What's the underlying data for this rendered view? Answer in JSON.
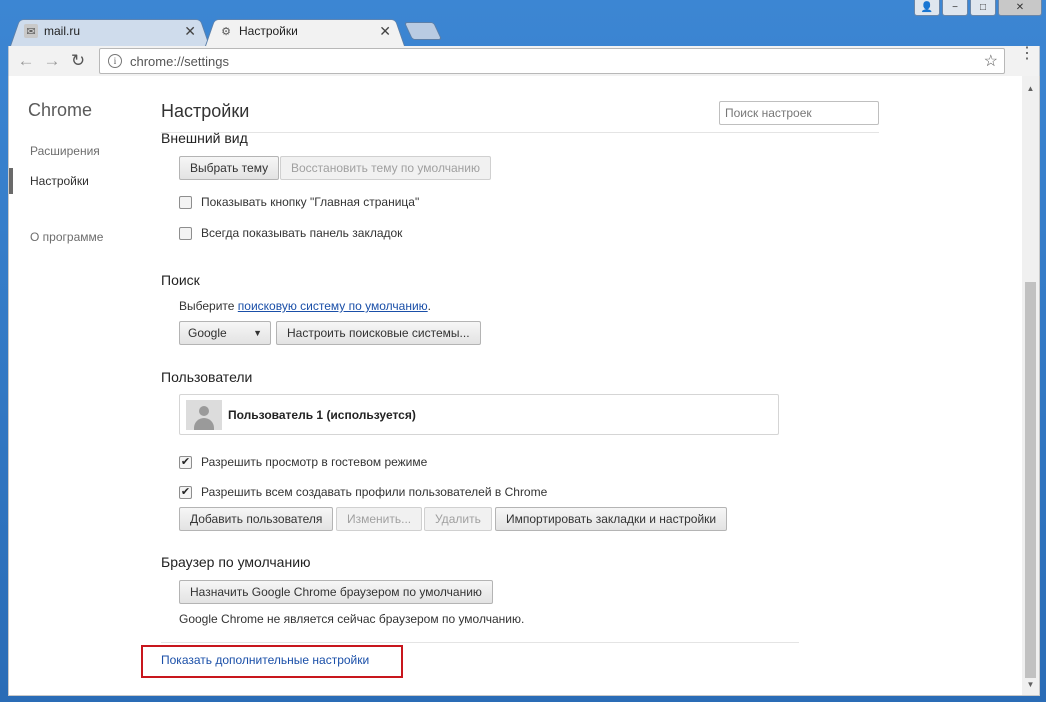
{
  "window": {
    "minimize_icon": "−",
    "maximize_icon": "□",
    "close_icon": "✕"
  },
  "tabs": [
    {
      "title": "mail.ru",
      "icon": "mail-icon",
      "active": false
    },
    {
      "title": "Настройки",
      "icon": "gear-icon",
      "active": true
    }
  ],
  "toolbar": {
    "back": "←",
    "forward": "→",
    "reload": "↻",
    "url": "chrome://settings",
    "info_icon": "i",
    "star": "☆",
    "menu": "⋮"
  },
  "nav": {
    "title": "Chrome",
    "items": [
      {
        "label": "Расширения"
      },
      {
        "label": "Настройки"
      },
      {
        "label": "О программе"
      }
    ]
  },
  "header": {
    "title": "Настройки",
    "search_placeholder": "Поиск настроек"
  },
  "appearance": {
    "title": "Внешний вид",
    "choose_theme": "Выбрать тему",
    "reset_theme": "Восстановить тему по умолчанию",
    "show_home": "Показывать кнопку \"Главная страница\"",
    "show_bookmarks": "Всегда показывать панель закладок"
  },
  "search": {
    "title": "Поиск",
    "prefix": "Выберите ",
    "link": "поисковую систему по умолчанию",
    "suffix": ".",
    "engine": "Google",
    "manage": "Настроить поисковые системы..."
  },
  "users": {
    "title": "Пользователи",
    "current_user": "Пользователь 1 (используется)",
    "guest": "Разрешить просмотр в гостевом режиме",
    "anyone": "Разрешить всем создавать профили пользователей в Chrome",
    "add": "Добавить пользователя",
    "edit": "Изменить...",
    "delete": "Удалить",
    "import": "Импортировать закладки и настройки"
  },
  "default_browser": {
    "title": "Браузер по умолчанию",
    "make_default": "Назначить Google Chrome браузером по умолчанию",
    "status": "Google Chrome не является сейчас браузером по умолчанию."
  },
  "footer": {
    "advanced_link": "Показать дополнительные настройки"
  },
  "colors": {
    "link": "#1a4fa8",
    "highlight": "#c8161d",
    "titlebar": "#2f6fb8"
  }
}
